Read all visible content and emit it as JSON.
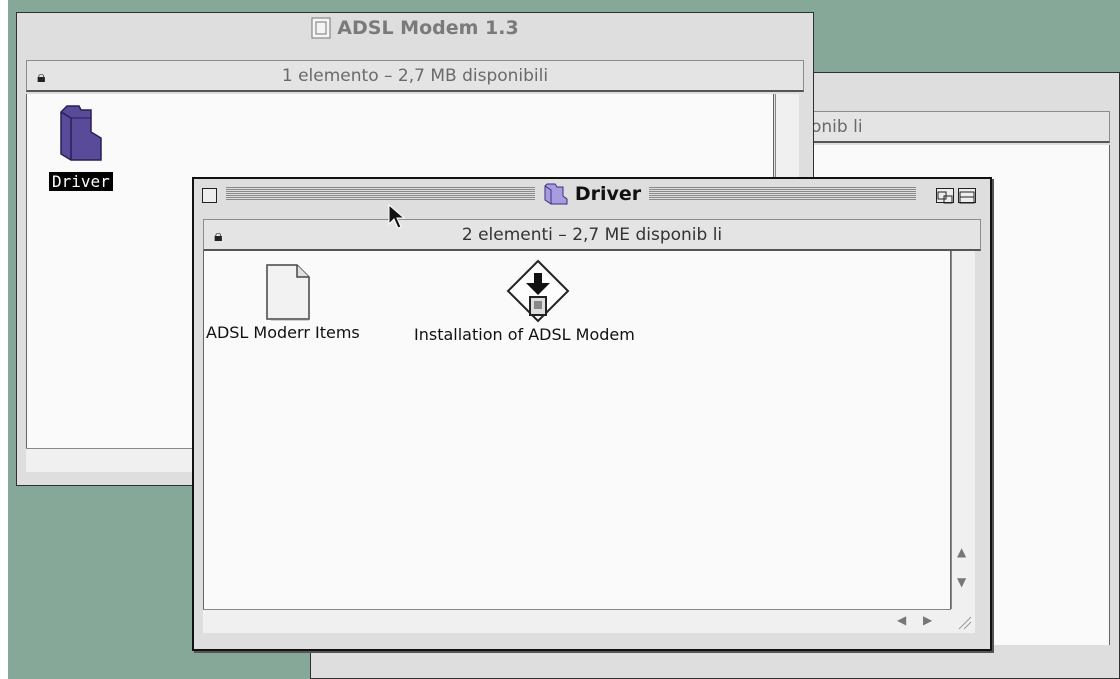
{
  "windows": {
    "back_right": {
      "info_fragment": "onib li"
    },
    "adsl": {
      "title": "ADSL Modem 1.3",
      "info": "1 elemento – 2,7 MB disponibili",
      "items": [
        {
          "label": "Driver",
          "icon": "folder-icon"
        }
      ]
    },
    "driver": {
      "title": "Driver",
      "info": "2 elementi – 2,7 ME disponib li",
      "items": [
        {
          "label": "ADSL Moderr Items",
          "icon": "document-icon"
        },
        {
          "label": "Installation of ADSL Modem",
          "icon": "installer-icon"
        }
      ]
    }
  },
  "colors": {
    "desktop": "#85a898",
    "window": "#dedede",
    "folder": "#5a4a9a"
  },
  "icons": {
    "lock": "lock-icon",
    "close": "close-box-icon",
    "zoom": "zoom-box-icon",
    "collapse": "collapse-box-icon"
  }
}
